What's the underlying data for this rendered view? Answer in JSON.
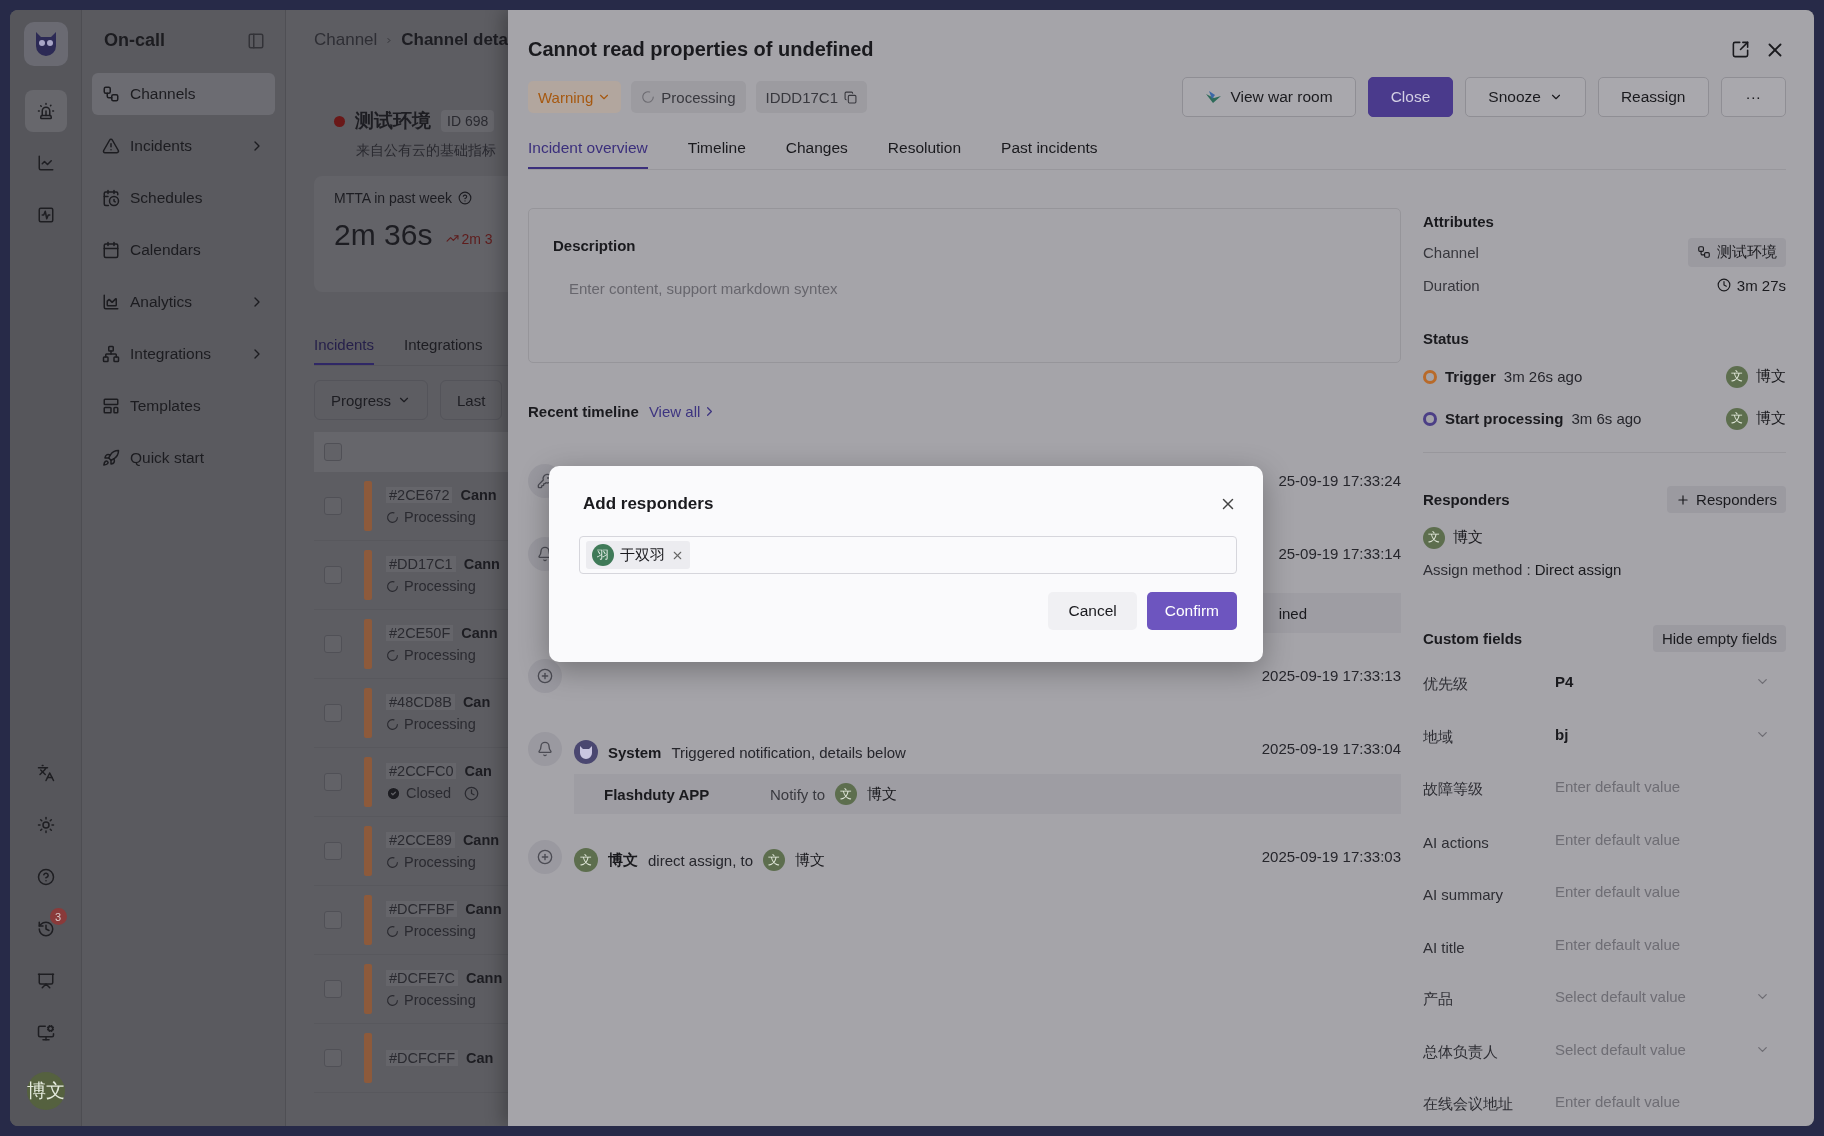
{
  "app": {
    "name": "On-call",
    "user_avatar": "博文"
  },
  "rail": {
    "top": [
      {
        "kind": "siren",
        "selected": true
      },
      {
        "kind": "chart",
        "selected": false
      },
      {
        "kind": "activity",
        "selected": false
      }
    ],
    "bottom": [
      {
        "kind": "language"
      },
      {
        "kind": "theme"
      },
      {
        "kind": "help"
      },
      {
        "kind": "history",
        "badge": "3"
      },
      {
        "kind": "presentation"
      },
      {
        "kind": "monitor"
      }
    ]
  },
  "sidebar": {
    "items": [
      {
        "kind": "channels",
        "label": "Channels",
        "selected": true,
        "expandable": false
      },
      {
        "kind": "incidents",
        "label": "Incidents",
        "selected": false,
        "expandable": true
      },
      {
        "kind": "schedules",
        "label": "Schedules",
        "selected": false,
        "expandable": false
      },
      {
        "kind": "calendars",
        "label": "Calendars",
        "selected": false,
        "expandable": false
      },
      {
        "kind": "analytics",
        "label": "Analytics",
        "selected": false,
        "expandable": true
      },
      {
        "kind": "integrations",
        "label": "Integrations",
        "selected": false,
        "expandable": true
      },
      {
        "kind": "templates",
        "label": "Templates",
        "selected": false,
        "expandable": false
      },
      {
        "kind": "quickstart",
        "label": "Quick start",
        "selected": false,
        "expandable": false
      }
    ]
  },
  "channel_page": {
    "breadcrumb": [
      "Channel",
      "Channel deta"
    ],
    "name": "测试环境",
    "id": "ID 698",
    "description": "来自公有云的基础指标",
    "metric": {
      "label": "MTTA in past week",
      "value": "2m 36s",
      "trend": "2m 3"
    },
    "tabs": [
      {
        "label": "Incidents",
        "selected": true
      },
      {
        "label": "Integrations",
        "selected": false
      }
    ],
    "filters": [
      "Progress",
      "Last"
    ],
    "select_all_checked": false,
    "rows": [
      {
        "id": "#2CE672",
        "title": "Cann",
        "status": "Processing",
        "kind": "processing",
        "checked": false
      },
      {
        "id": "#DD17C1",
        "title": "Cann",
        "status": "Processing",
        "kind": "processing",
        "checked": false
      },
      {
        "id": "#2CE50F",
        "title": "Cann",
        "status": "Processing",
        "kind": "processing",
        "checked": false
      },
      {
        "id": "#48CD8B",
        "title": "Can",
        "status": "Processing",
        "kind": "processing",
        "checked": false
      },
      {
        "id": "#2CCFC0",
        "title": "Can",
        "status": "Closed",
        "kind": "closed",
        "checked": false
      },
      {
        "id": "#2CCE89",
        "title": "Cann",
        "status": "Processing",
        "kind": "processing",
        "checked": false
      },
      {
        "id": "#DCFFBF",
        "title": "Cann",
        "status": "Processing",
        "kind": "processing",
        "checked": false
      },
      {
        "id": "#DCFE7C",
        "title": "Cann",
        "status": "Processing",
        "kind": "processing",
        "checked": false
      },
      {
        "id": "#DCFCFF",
        "title": "Can",
        "kind": "none",
        "checked": false
      }
    ]
  },
  "incident": {
    "title": "Cannot read properties of undefined",
    "severity": "Warning",
    "progress": "Processing",
    "id": "IDDD17C1",
    "actions": [
      {
        "kind": "warroom",
        "label": "View war room"
      },
      {
        "kind": "primary",
        "label": "Close"
      },
      {
        "kind": "dropdown",
        "label": "Snooze"
      },
      {
        "kind": "default",
        "label": "Reassign"
      },
      {
        "kind": "more",
        "label": "···"
      }
    ],
    "tabs": [
      {
        "label": "Incident overview",
        "selected": true
      },
      {
        "label": "Timeline",
        "selected": false
      },
      {
        "label": "Changes",
        "selected": false
      },
      {
        "label": "Resolution",
        "selected": false
      },
      {
        "label": "Past incidents",
        "selected": false
      }
    ],
    "description": {
      "title": "Description",
      "placeholder": "Enter content, support markdown syntex"
    },
    "timeline": {
      "title": "Recent timeline",
      "link": "View all",
      "items": [
        {
          "kind": "edit",
          "time": "25-09-19 17:33:24"
        },
        {
          "kind": "bell",
          "time": "25-09-19 17:33:14",
          "detail": "ined"
        },
        {
          "kind": "plus",
          "time": "2025-09-19 17:33:13"
        },
        {
          "kind": "bell",
          "actor": "System",
          "text": "Triggered notification, details below",
          "time": "2025-09-19 17:33:04",
          "notify": {
            "channel": "Flashduty APP",
            "label": "Notify to",
            "avatar": "文",
            "person": "博文"
          }
        },
        {
          "kind": "plus",
          "actor": "博文",
          "actor_avatar": "文",
          "text": "direct assign, to",
          "target_avatar": "文",
          "target": "博文",
          "time": "2025-09-19 17:33:03"
        }
      ]
    },
    "attributes": {
      "title": "Attributes",
      "channel_label": "Channel",
      "channel": "测试环境",
      "duration_label": "Duration",
      "duration": "3m 27s"
    },
    "status": {
      "title": "Status",
      "items": [
        {
          "label": "Trigger",
          "ago": "3m 26s ago",
          "color": "#b86a2a",
          "avatar": "文",
          "person": "博文"
        },
        {
          "label": "Start processing",
          "ago": "3m 6s ago",
          "color": "#4c3f86",
          "avatar": "文",
          "person": "博文"
        }
      ]
    },
    "responders": {
      "title": "Responders",
      "add": "Responders",
      "people": [
        {
          "avatar": "文",
          "name": "博文"
        }
      ],
      "method_label": "Assign method :",
      "method": "Direct assign"
    },
    "custom_fields": {
      "title": "Custom fields",
      "toggle": "Hide empty fields",
      "fields": [
        {
          "label": "优先级",
          "kind": "select",
          "value": "P4"
        },
        {
          "label": "地域",
          "kind": "select",
          "value": "bj"
        },
        {
          "label": "故障等级",
          "kind": "input",
          "placeholder": "Enter default value"
        },
        {
          "label": "AI actions",
          "kind": "input",
          "placeholder": "Enter default value"
        },
        {
          "label": "AI summary",
          "kind": "input",
          "placeholder": "Enter default value"
        },
        {
          "label": "AI title",
          "kind": "input",
          "placeholder": "Enter default value"
        },
        {
          "label": "产品",
          "kind": "select",
          "placeholder": "Select default value"
        },
        {
          "label": "总体负责人",
          "kind": "select",
          "placeholder": "Select default value"
        },
        {
          "label": "在线会议地址",
          "kind": "input",
          "placeholder": "Enter default value"
        }
      ]
    }
  },
  "modal": {
    "title": "Add responders",
    "tags": [
      {
        "avatar": "羽",
        "name": "于双羽"
      }
    ],
    "buttons": [
      {
        "kind": "default",
        "label": "Cancel"
      },
      {
        "kind": "primary",
        "label": "Confirm"
      }
    ]
  }
}
